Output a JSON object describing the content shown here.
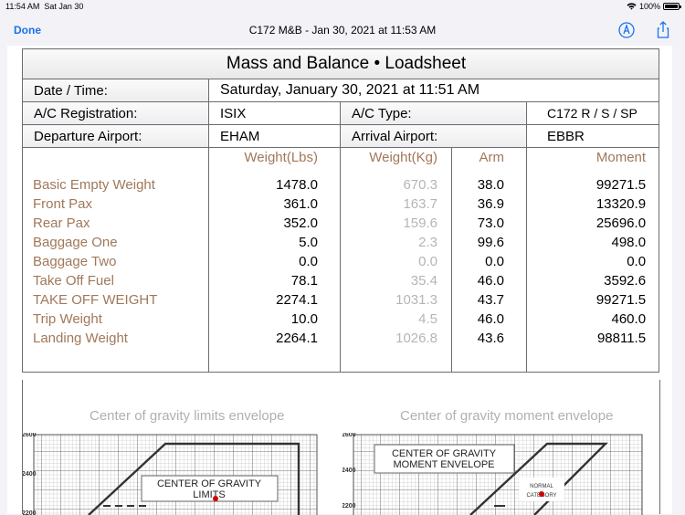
{
  "status_bar": {
    "time": "11:54 AM",
    "date": "Sat Jan 30",
    "battery": "100%",
    "wifi_icon": "wifi-icon",
    "battery_icon": "battery-icon"
  },
  "nav": {
    "done_label": "Done",
    "title": "C172 M&B - Jan 30, 2021 at 11:53 AM",
    "markup_icon": "markup-icon",
    "share_icon": "share-icon"
  },
  "loadsheet": {
    "title": "Mass and Balance • Loadsheet",
    "date_label": "Date / Time:",
    "date_value": "Saturday, January 30, 2021 at 11:51 AM",
    "reg_label": "A/C Registration:",
    "reg_value": "ISIX",
    "type_label": "A/C Type:",
    "type_value": "C172 R / S / SP",
    "dep_label": "Departure Airport:",
    "dep_value": "EHAM",
    "arr_label": "Arrival Airport:",
    "arr_value": "EBBR",
    "columns": {
      "lbs": "Weight(Lbs)",
      "kg": "Weight(Kg)",
      "arm": "Arm",
      "moment": "Moment"
    },
    "rows": [
      {
        "name": "Basic Empty Weight",
        "lbs": "1478.0",
        "kg": "670.3",
        "arm": "38.0",
        "moment": "99271.5"
      },
      {
        "name": "Front Pax",
        "lbs": "361.0",
        "kg": "163.7",
        "arm": "36.9",
        "moment": "13320.9"
      },
      {
        "name": "Rear Pax",
        "lbs": "352.0",
        "kg": "159.6",
        "arm": "73.0",
        "moment": "25696.0"
      },
      {
        "name": "Baggage One",
        "lbs": "5.0",
        "kg": "2.3",
        "arm": "99.6",
        "moment": "498.0"
      },
      {
        "name": "Baggage Two",
        "lbs": "0.0",
        "kg": "0.0",
        "arm": "0.0",
        "moment": "0.0"
      },
      {
        "name": "Take Off Fuel",
        "lbs": "78.1",
        "kg": "35.4",
        "arm": "46.0",
        "moment": "3592.6"
      },
      {
        "name": "TAKE OFF WEIGHT",
        "lbs": "2274.1",
        "kg": "1031.3",
        "arm": "43.7",
        "moment": "99271.5"
      },
      {
        "name": "Trip Weight",
        "lbs": "10.0",
        "kg": "4.5",
        "arm": "46.0",
        "moment": "460.0"
      },
      {
        "name": "Landing Weight",
        "lbs": "2264.1",
        "kg": "1026.8",
        "arm": "43.6",
        "moment": "98811.5"
      }
    ]
  },
  "charts": {
    "limits": {
      "title": "Center of gravity limits envelope",
      "box_line1": "CENTER OF GRAVITY",
      "box_line2": "LIMITS",
      "ticks": [
        "2600",
        "2400",
        "2200"
      ]
    },
    "moment": {
      "title": "Center of gravity moment envelope",
      "box_line1": "CENTER OF GRAVITY",
      "box_line2": "MOMENT ENVELOPE",
      "small_line1": "NORMAL",
      "small_line2": "CATEGORY",
      "ticks": [
        "2600",
        "2400",
        "2200"
      ]
    }
  }
}
